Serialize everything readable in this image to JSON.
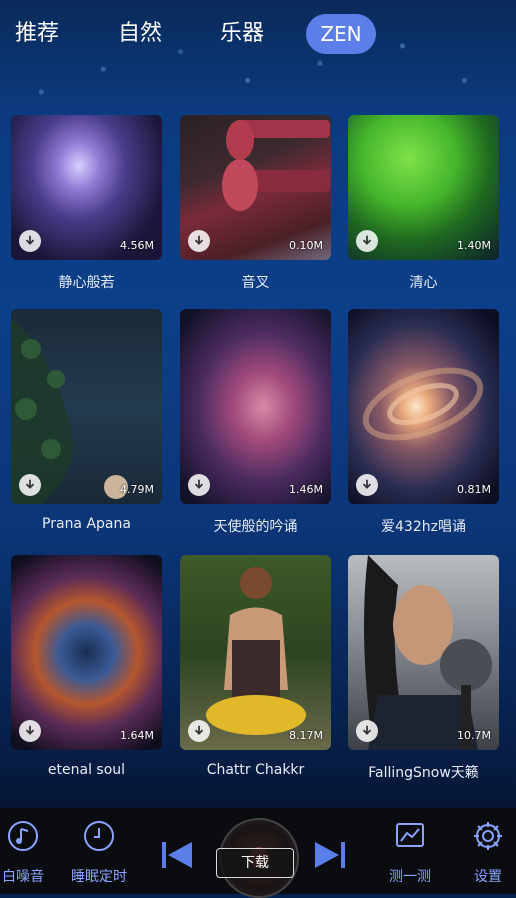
{
  "tabs": [
    {
      "label": "推荐"
    },
    {
      "label": "自然"
    },
    {
      "label": "乐器"
    },
    {
      "label": "ZEN"
    }
  ],
  "active_tab": "ZEN",
  "items": [
    {
      "title": "静心般若",
      "size": "4.56M"
    },
    {
      "title": "音叉",
      "size": "0.10M"
    },
    {
      "title": "清心",
      "size": "1.40M"
    },
    {
      "title": "Prana Apana",
      "size": "4.79M"
    },
    {
      "title": "天使般的吟诵",
      "size": "1.46M"
    },
    {
      "title": "爱432hz唱诵",
      "size": "0.81M"
    },
    {
      "title": "etenal soul",
      "size": "1.64M"
    },
    {
      "title": "Chattr Chakkr",
      "size": "8.17M"
    },
    {
      "title": "FallingSnow天籁",
      "size": "10.7M"
    }
  ],
  "bottom_nav": {
    "white_noise": "白噪音",
    "sleep_timer": "睡眠定时",
    "test": "测一测",
    "settings": "设置",
    "download": "下载"
  },
  "colors": {
    "accent": "#5b7ee8",
    "nav_label": "#8aa4ff"
  }
}
